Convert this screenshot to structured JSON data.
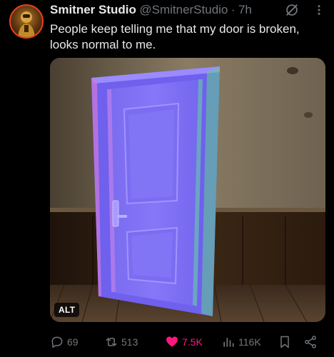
{
  "tweet": {
    "author_name": "Smitner Studio",
    "handle": "@SmitnerStudio",
    "separator": "·",
    "time": "7h",
    "text": "People keep telling me that my door is broken, looks normal to me.",
    "media_alt_badge": "ALT"
  },
  "actions": {
    "replies": "69",
    "reposts": "513",
    "likes": "7.5K",
    "views": "116K"
  },
  "icons": {
    "grok": "grok-icon",
    "more": "more-icon",
    "reply": "reply-icon",
    "repost": "repost-icon",
    "like": "heart-icon",
    "views": "views-icon",
    "bookmark": "bookmark-icon",
    "share": "share-icon"
  },
  "colors": {
    "background": "#000000",
    "text": "#e7e9ea",
    "muted": "#71767b",
    "like_pink": "#f91880"
  }
}
